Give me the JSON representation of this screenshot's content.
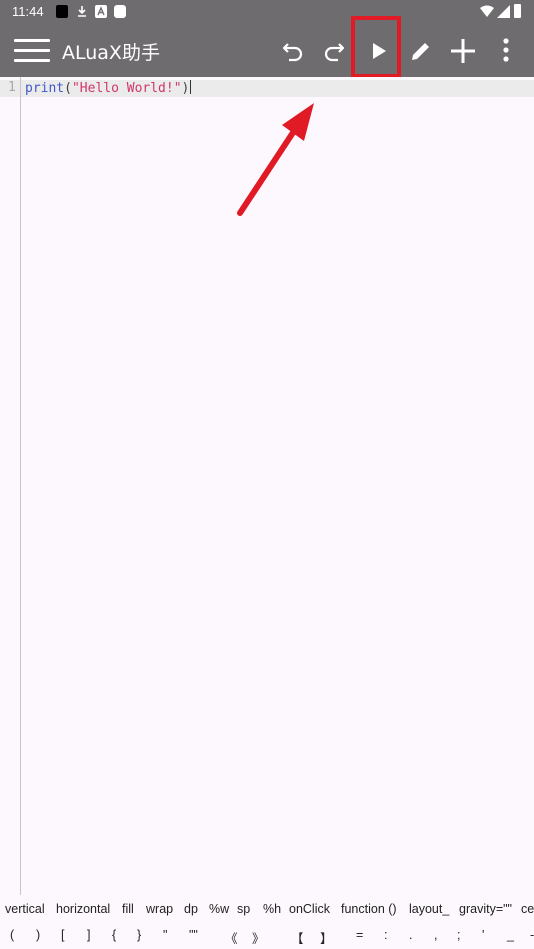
{
  "status_bar": {
    "time": "11:44"
  },
  "app_bar": {
    "title": "ALuaX助手"
  },
  "editor": {
    "line_number": "1",
    "code_keyword": "print",
    "code_open": "(",
    "code_string": "\"Hello World!\"",
    "code_close": ")"
  },
  "symbols_row1": [
    "vertical",
    "horizontal",
    "fill",
    "wrap",
    "dp",
    "%w",
    "sp",
    "%h",
    "onClick",
    "function ()",
    "layout_",
    "gravity=\"\"",
    "ce"
  ],
  "symbols_row2": [
    "(",
    ")",
    "[",
    "]",
    "{",
    "}",
    "\"",
    "\"\"",
    "《",
    "》",
    "【",
    "】",
    "=",
    ":",
    ".",
    ",",
    ";",
    "'",
    "_",
    "-"
  ],
  "colors": {
    "app_bar": "#6e6c6e",
    "highlight": "#e01b26",
    "background": "#fdf8fd"
  }
}
